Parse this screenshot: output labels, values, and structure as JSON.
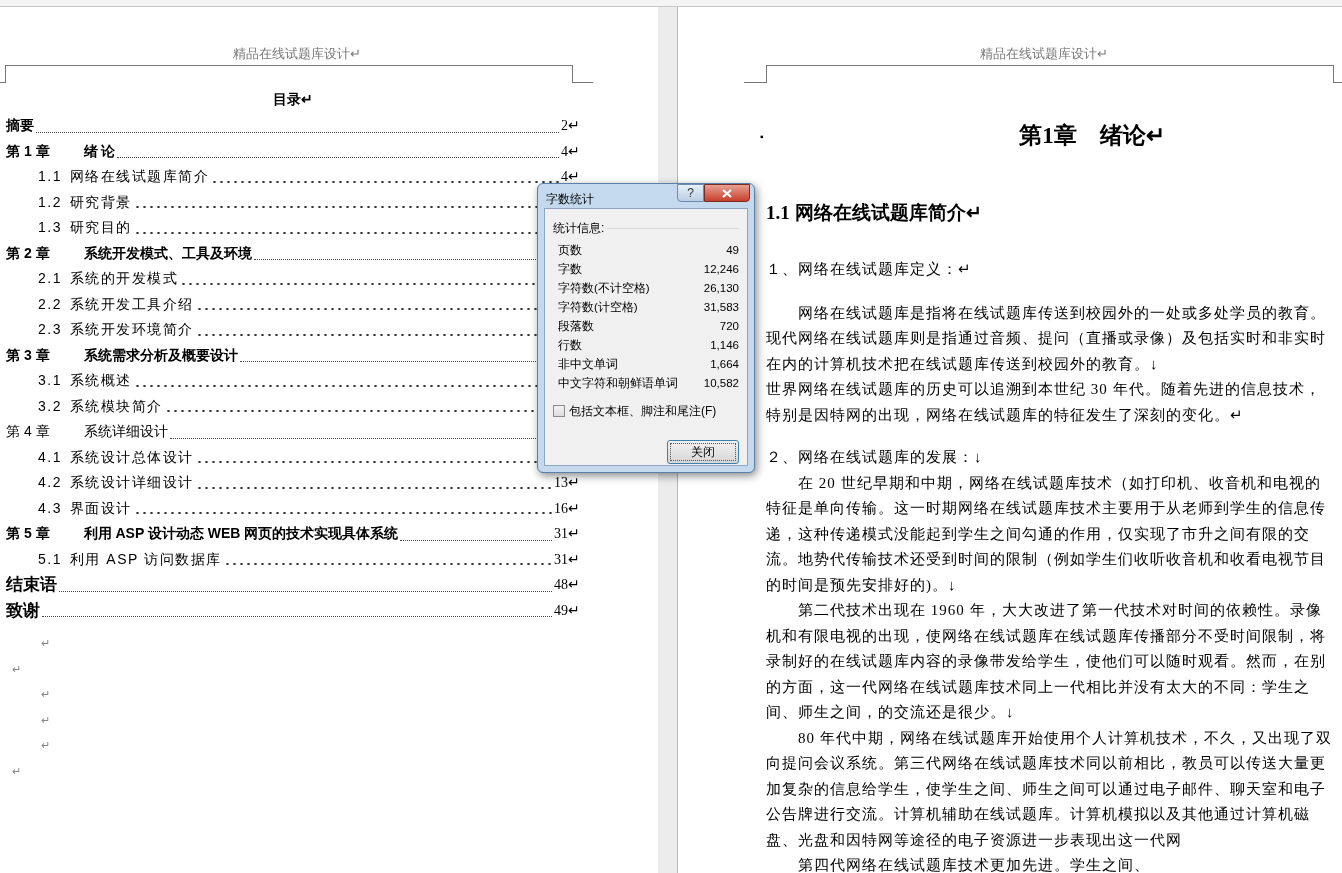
{
  "left_page": {
    "header": "精品在线试题库设计↵",
    "toc_title": "目录↵",
    "toc": [
      {
        "kind": "bold_chapter",
        "title": "摘要",
        "page": "2↵"
      },
      {
        "kind": "bold_chapter",
        "number": "第 1 章",
        "title": "绪 论",
        "page": "4↵"
      },
      {
        "kind": "section",
        "number": "1.1",
        "title": "网络在线试题库简介",
        "page": "4↵"
      },
      {
        "kind": "section",
        "number": "1.2",
        "title": "研究背景"
      },
      {
        "kind": "section",
        "number": "1.3",
        "title": "研究目的"
      },
      {
        "kind": "bold_chapter",
        "number": "第 2 章",
        "title": "系统开发模式、工具及环境"
      },
      {
        "kind": "section",
        "number": "2.1",
        "title": "系统的开发模式"
      },
      {
        "kind": "section",
        "number": "2.2",
        "title": "系统开发工具介绍"
      },
      {
        "kind": "section",
        "number": "2.3",
        "title": "系统开发环境简介"
      },
      {
        "kind": "bold_chapter",
        "number": "第 3 章",
        "title": "系统需求分析及概要设计"
      },
      {
        "kind": "section",
        "number": "3.1",
        "title": "系统概述"
      },
      {
        "kind": "section",
        "number": "3.2",
        "title": "系统模块简介"
      },
      {
        "kind": "chapter",
        "number": "第 4 章",
        "title": "系统详细设计"
      },
      {
        "kind": "section",
        "number": "4.1",
        "title": "系统设计总体设计"
      },
      {
        "kind": "section",
        "number": "4.2",
        "title": "系统设计详细设计",
        "page": "13↵"
      },
      {
        "kind": "section",
        "number": "4.3",
        "title": "界面设计",
        "page": "16↵"
      },
      {
        "kind": "bold_chapter",
        "number": "第 5 章",
        "title": "利用 ASP 设计动态 WEB 网页的技术实现具体系统",
        "page": "31↵"
      },
      {
        "kind": "section",
        "number": "5.1",
        "title": "利用 ASP 访问数据库",
        "page": "31↵"
      },
      {
        "kind": "closing",
        "title": "结束语",
        "page": "48↵"
      },
      {
        "kind": "closing",
        "title": "致谢",
        "page": "49↵"
      }
    ],
    "paragraph_marks": [
      {
        "kind": "indented",
        "mark": "↵"
      },
      {
        "kind": "flush",
        "mark": "↵"
      },
      {
        "kind": "indented",
        "mark": "↵"
      },
      {
        "kind": "indented",
        "mark": "↵"
      },
      {
        "kind": "indented",
        "mark": "↵"
      },
      {
        "kind": "flush",
        "mark": "↵"
      }
    ]
  },
  "right_page": {
    "header": "精品在线试题库设计↵",
    "bullet": "▪",
    "chapter_title": "第1章　绪论↵",
    "section_title": "1.1 网络在线试题库简介↵",
    "paragraphs": [
      {
        "kind": "subheading",
        "text": "１、网络在线试题库定义：↵"
      },
      {
        "kind": "body",
        "text": "网络在线试题库是指将在线试题库传送到校园外的一处或多处学员的教育。现代网络在线试题库则是指通过音频、提问（直播或录像）及包括实时和非实时在内的计算机技术把在线试题库传送到校园外的教育。↓"
      },
      {
        "kind": "plain",
        "text": "世界网络在线试题库的历史可以追溯到本世纪 30 年代。随着先进的信息技术，特别是因特网的出现，网络在线试题库的特征发生了深刻的变化。↵"
      },
      {
        "kind": "subheading",
        "text": "２、网络在线试题库的发展：↓"
      },
      {
        "kind": "body",
        "text": "在 20 世纪早期和中期，网络在线试题库技术（如打印机、收音机和电视的特征是单向传输。这一时期网络在线试题库技术主要用于从老师到学生的信息传递，这种传递模式没能起到学生之间勾通的作用，仅实现了市升之间有限的交流。地势代传输技术还受到时间的限制（例如学生们收听收音机和收看电视节目的时间是预先安排好的)。↓"
      },
      {
        "kind": "body",
        "text": "第二代技术出现在 1960 年，大大改进了第一代技术对时间的依赖性。录像机和有限电视的出现，使网络在线试题库在线试题库传播部分不受时间限制，将录制好的在线试题库内容的录像带发给学生，使他们可以随时观看。然而，在别的方面，这一代网络在线试题库技术同上一代相比并没有太大的不同：学生之间、师生之间，的交流还是很少。↓"
      },
      {
        "kind": "body",
        "text": "80 年代中期，网络在线试题库开始使用个人计算机技术，不久，又出现了双向提问会议系统。第三代网络在线试题库技术同以前相比，教员可以传送大量更加复杂的信息给学生，使学生之间、师生之间可以通过电子邮件、聊天室和电子公告牌进行交流。计算机辅助在线试题库。计算机模拟以及其他通过计算机磁盘、光盘和因特网等途径的电子资源进一步表现出这一代网"
      },
      {
        "kind": "body",
        "text": "第四代网络在线试题库技术更加先进。学生之间、"
      }
    ]
  },
  "dialog": {
    "title": "字数统计",
    "help_label": "?",
    "stats_label": "统计信息:",
    "stats": [
      {
        "label": "页数",
        "value": "49"
      },
      {
        "label": "字数",
        "value": "12,246"
      },
      {
        "label": "字符数(不计空格)",
        "value": "26,130"
      },
      {
        "label": "字符数(计空格)",
        "value": "31,583"
      },
      {
        "label": "段落数",
        "value": "720"
      },
      {
        "label": "行数",
        "value": "1,146"
      },
      {
        "label": "非中文单词",
        "value": "1,664"
      },
      {
        "label": "中文字符和朝鲜语单词",
        "value": "10,582"
      }
    ],
    "include_checkbox": {
      "label": "包括文本框、脚注和尾注(F)",
      "checked": false
    },
    "close_button": "关闭"
  }
}
